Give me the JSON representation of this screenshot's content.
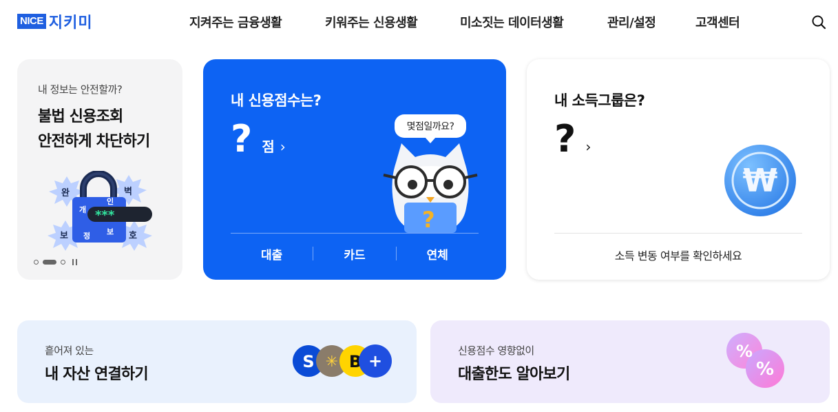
{
  "header": {
    "logo_badge": "NICE",
    "logo_name": "지키미",
    "nav": [
      {
        "label": "지켜주는 금융생활"
      },
      {
        "label": "키워주는 신용생활"
      },
      {
        "label": "미소짓는 데이터생활"
      },
      {
        "label": "관리/설정"
      },
      {
        "label": "고객센터"
      }
    ],
    "search_icon": "search-icon"
  },
  "security_card": {
    "subtitle": "내 정보는 안전할까?",
    "title_line1": "불법 신용조회",
    "title_line2": "안전하게 차단하기",
    "badge_chars": [
      "완",
      "벽",
      "보",
      "호",
      "개",
      "인",
      "정",
      "보"
    ],
    "password_mask": "***"
  },
  "credit_card": {
    "title": "내 신용점수는?",
    "score": "?",
    "unit": "점",
    "arrow": "›",
    "bubble": "몇점일까요?",
    "links": [
      "대출",
      "카드",
      "연체"
    ]
  },
  "income_card": {
    "title": "내 소득그룹은?",
    "value": "?",
    "arrow": "›",
    "coin_symbol": "₩",
    "link": "소득 변동 여부를 확인하세요"
  },
  "asset_banner": {
    "subtitle": "흩어져 있는",
    "title": "내 자산 연결하기",
    "logo_letters": [
      "S",
      "✳",
      "B",
      "+"
    ]
  },
  "loan_banner": {
    "subtitle": "신용점수 영향없이",
    "title": "대출한도 알아보기"
  },
  "colors": {
    "brand_blue": "#0d63f3",
    "logo_blue": "#1f5fe0",
    "asset_bg": "#e9f1fd",
    "loan_bg": "#efeafc"
  }
}
